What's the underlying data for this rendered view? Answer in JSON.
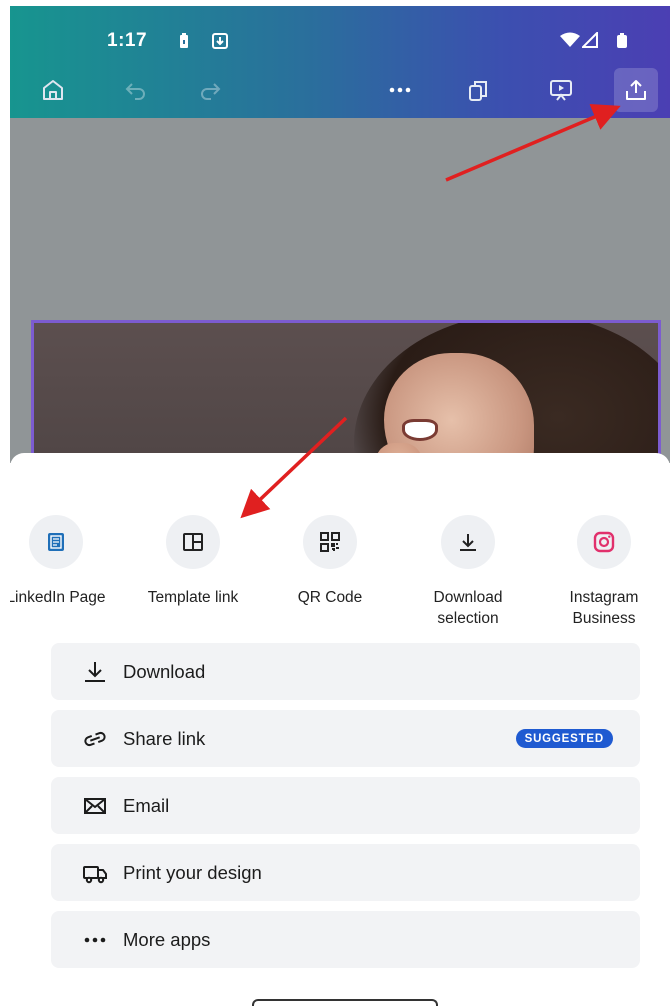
{
  "status_bar": {
    "time": "1:17"
  },
  "icons": {
    "home": "home-icon",
    "undo": "undo-icon",
    "redo": "redo-icon",
    "more": "more-icon",
    "pages": "pages-icon",
    "present": "present-icon",
    "share": "share-upload-icon"
  },
  "share_apps": [
    {
      "label": "LinkedIn Page",
      "icon": "linkedin-page-icon"
    },
    {
      "label": "Template link",
      "icon": "template-link-icon"
    },
    {
      "label": "QR Code",
      "icon": "qr-code-icon"
    },
    {
      "label": "Download selection",
      "icon": "download-icon"
    },
    {
      "label": "Instagram Business",
      "icon": "instagram-icon"
    }
  ],
  "share_options": [
    {
      "label": "Download",
      "icon": "download-icon"
    },
    {
      "label": "Share link",
      "icon": "link-icon",
      "badge": "SUGGESTED"
    },
    {
      "label": "Email",
      "icon": "email-icon"
    },
    {
      "label": "Print your design",
      "icon": "print-truck-icon"
    },
    {
      "label": "More apps",
      "icon": "more-dots-icon"
    }
  ],
  "colors": {
    "header_start": "#17958f",
    "header_end": "#4b3fb3",
    "selection_border": "#7c5cd0",
    "badge": "#1f5ad1",
    "annotation_arrow": "#e02020"
  }
}
